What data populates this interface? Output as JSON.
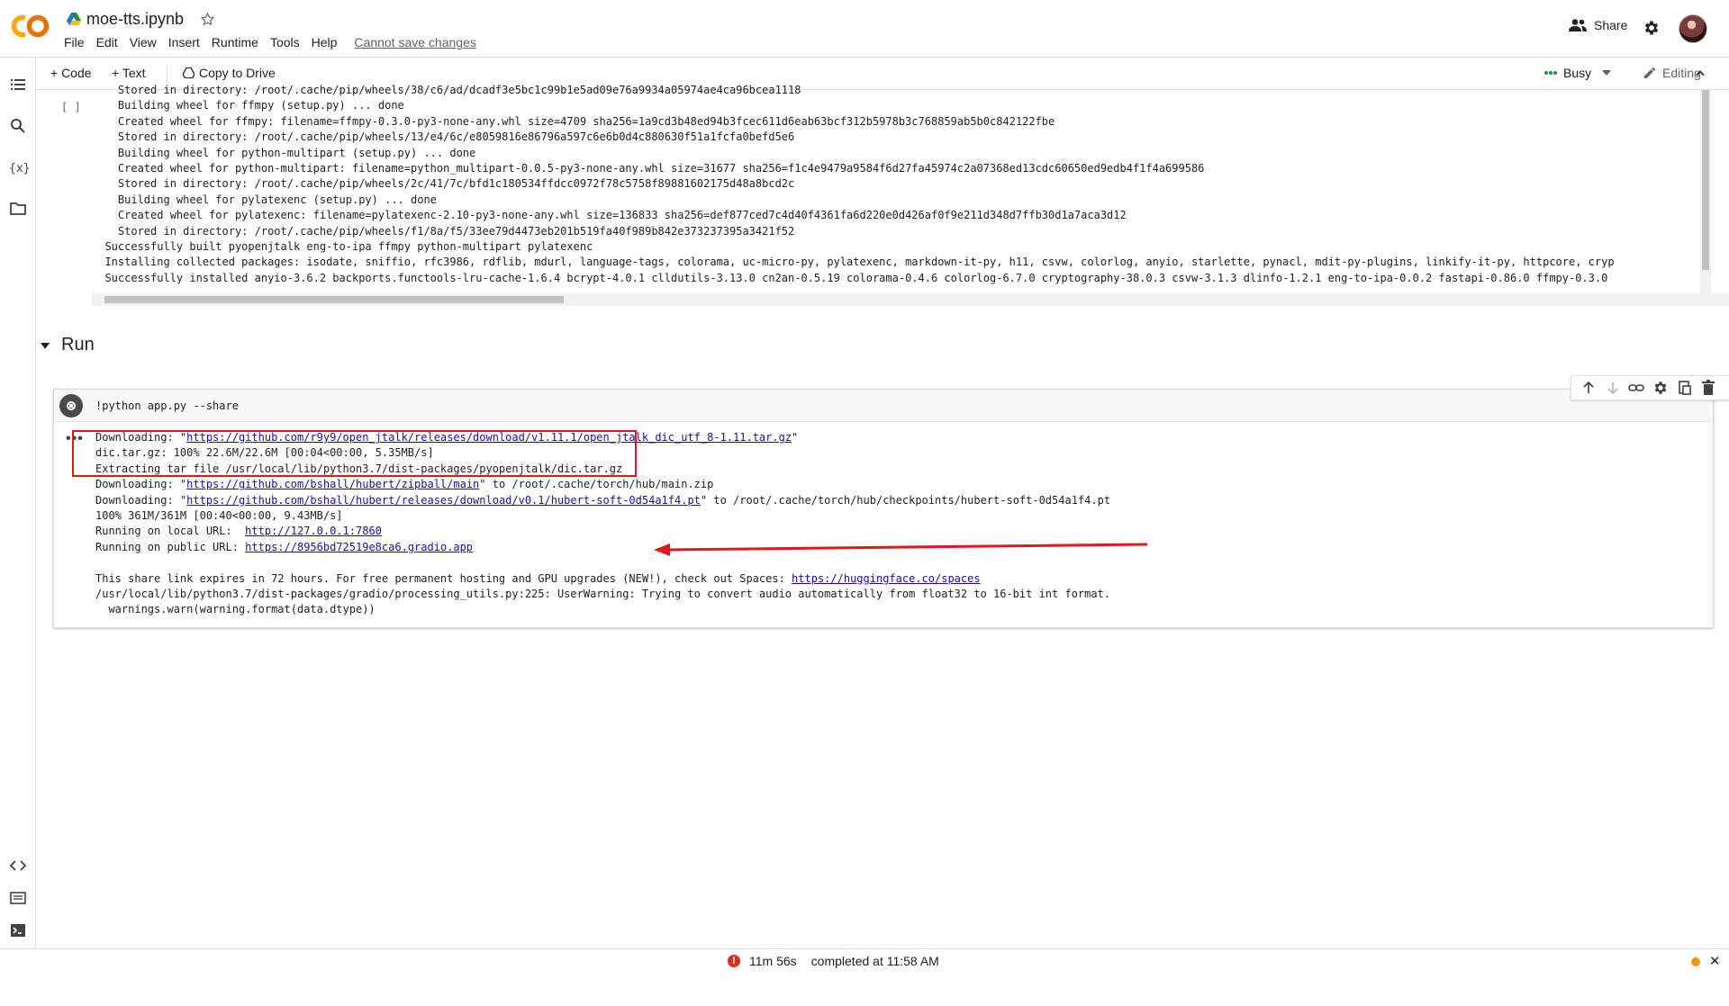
{
  "app": {
    "notebook_title": "moe-tts.ipynb",
    "menu": [
      "File",
      "Edit",
      "View",
      "Insert",
      "Runtime",
      "Tools",
      "Help"
    ],
    "cannot_save": "Cannot save changes",
    "share_label": "Share"
  },
  "toolbar": {
    "add_code": "+ Code",
    "add_text": "+ Text",
    "copy_to_drive": "Copy to Drive",
    "busy": "Busy",
    "editing": "Editing"
  },
  "cell1": {
    "run_indicator": "[ ]",
    "output_lines": [
      "    Stored in directory: /root/.cache/pip/wheels/38/c6/ad/dcadf3e5bc1c99b1e5ad09e76a9934a05974ae4ca96bcea1118",
      "    Building wheel for ffmpy (setup.py) ... done",
      "    Created wheel for ffmpy: filename=ffmpy-0.3.0-py3-none-any.whl size=4709 sha256=1a9cd3b48ed94b3fcec611d6eab63bcf312b5978b3c768859ab5b0c842122fbe",
      "    Stored in directory: /root/.cache/pip/wheels/13/e4/6c/e8059816e86796a597c6e6b0d4c880630f51a1fcfa0befd5e6",
      "    Building wheel for python-multipart (setup.py) ... done",
      "    Created wheel for python-multipart: filename=python_multipart-0.0.5-py3-none-any.whl size=31677 sha256=f1c4e9479a9584f6d27fa45974c2a07368ed13cdc60650ed9edb4f1f4a699586",
      "    Stored in directory: /root/.cache/pip/wheels/2c/41/7c/bfd1c180534ffdcc0972f78c5758f89881602175d48a8bcd2c",
      "    Building wheel for pylatexenc (setup.py) ... done",
      "    Created wheel for pylatexenc: filename=pylatexenc-2.10-py3-none-any.whl size=136833 sha256=def877ced7c4d40f4361fa6d220e0d426af0f9e211d348d7ffb30d1a7aca3d12",
      "    Stored in directory: /root/.cache/pip/wheels/f1/8a/f5/33ee79d4473eb201b519fa40f989b842e373237395a3421f52",
      "  Successfully built pyopenjtalk eng-to-ipa ffmpy python-multipart pylatexenc",
      "  Installing collected packages: isodate, sniffio, rfc3986, rdflib, mdurl, language-tags, colorama, uc-micro-py, pylatexenc, markdown-it-py, h11, csvw, colorlog, anyio, starlette, pynacl, mdit-py-plugins, linkify-it-py, httpcore, cryp",
      "  Successfully installed anyio-3.6.2 backports.functools-lru-cache-1.6.4 bcrypt-4.0.1 clldutils-3.13.0 cn2an-0.5.19 colorama-0.4.6 colorlog-6.7.0 cryptography-38.0.3 csvw-3.1.3 dlinfo-1.2.1 eng-to-ipa-0.0.2 fastapi-0.86.0 ffmpy-0.3.0"
    ]
  },
  "section": {
    "title": "Run"
  },
  "cell2": {
    "code": "!python app.py --share",
    "out_dots": "•••",
    "output": {
      "l1_prefix": "Downloading: \"",
      "l1_url": "https://github.com/r9y9/open_jtalk/releases/download/v1.11.1/open_jtalk_dic_utf_8-1.11.tar.gz",
      "l1_suffix": "\"",
      "l2": "dic.tar.gz: 100% 22.6M/22.6M [00:04<00:00, 5.35MB/s]",
      "l3": "Extracting tar file /usr/local/lib/python3.7/dist-packages/pyopenjtalk/dic.tar.gz",
      "l4_prefix": "Downloading: \"",
      "l4_url": "https://github.com/bshall/hubert/zipball/main",
      "l4_suffix": "\" to /root/.cache/torch/hub/main.zip",
      "l5_prefix": "Downloading: \"",
      "l5_url": "https://github.com/bshall/hubert/releases/download/v0.1/hubert-soft-0d54a1f4.pt",
      "l5_suffix": "\" to /root/.cache/torch/hub/checkpoints/hubert-soft-0d54a1f4.pt",
      "l6": "100% 361M/361M [00:40<00:00, 9.43MB/s]",
      "l7_prefix": "Running on local URL:  ",
      "l7_url": "http://127.0.0.1:7860",
      "l8_prefix": "Running on public URL: ",
      "l8_url": "https://8956bd72519e8ca6.gradio.app",
      "l10_prefix": "This share link expires in 72 hours. For free permanent hosting and GPU upgrades (NEW!), check out Spaces: ",
      "l10_url": "https://huggingface.co/spaces",
      "l11": "/usr/local/lib/python3.7/dist-packages/gradio/processing_utils.py:225: UserWarning: Trying to convert audio automatically from float32 to 16-bit int format.",
      "l12": "  warnings.warn(warning.format(data.dtype))"
    }
  },
  "status": {
    "elapsed": "11m 56s",
    "completed": "completed at 11:58 AM",
    "error_glyph": "!",
    "close_glyph": "✕"
  },
  "colors": {
    "accent_orange": "#f9ab00",
    "highlight_red": "#e0181c",
    "link_blue": "#1a0dab"
  }
}
